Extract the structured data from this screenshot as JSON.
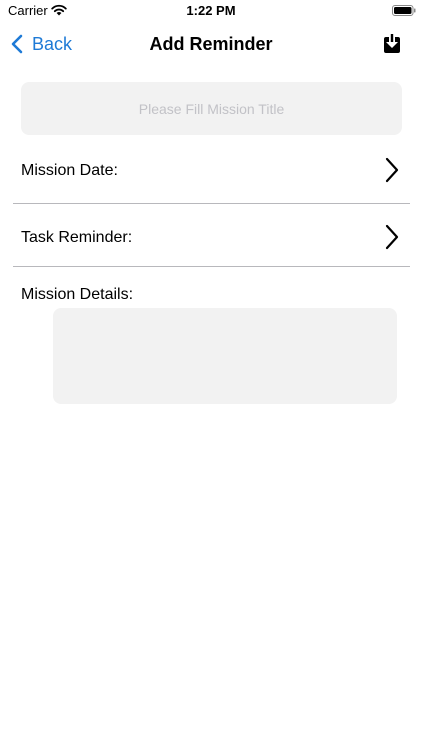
{
  "status_bar": {
    "carrier": "Carrier",
    "time": "1:22 PM",
    "wifi_icon": "wifi-icon",
    "battery_icon": "battery-icon"
  },
  "nav": {
    "back_label": "Back",
    "back_icon": "chevron-left-icon",
    "title": "Add Reminder",
    "save_icon": "download-icon",
    "accent_color": "#1e7ad6"
  },
  "form": {
    "title_placeholder": "Please Fill Mission Title",
    "title_value": "",
    "mission_date_label": "Mission Date:",
    "task_reminder_label": "Task Reminder:",
    "mission_details_label": "Mission Details:",
    "mission_details_value": "",
    "row_icon": "chevron-right-icon"
  }
}
